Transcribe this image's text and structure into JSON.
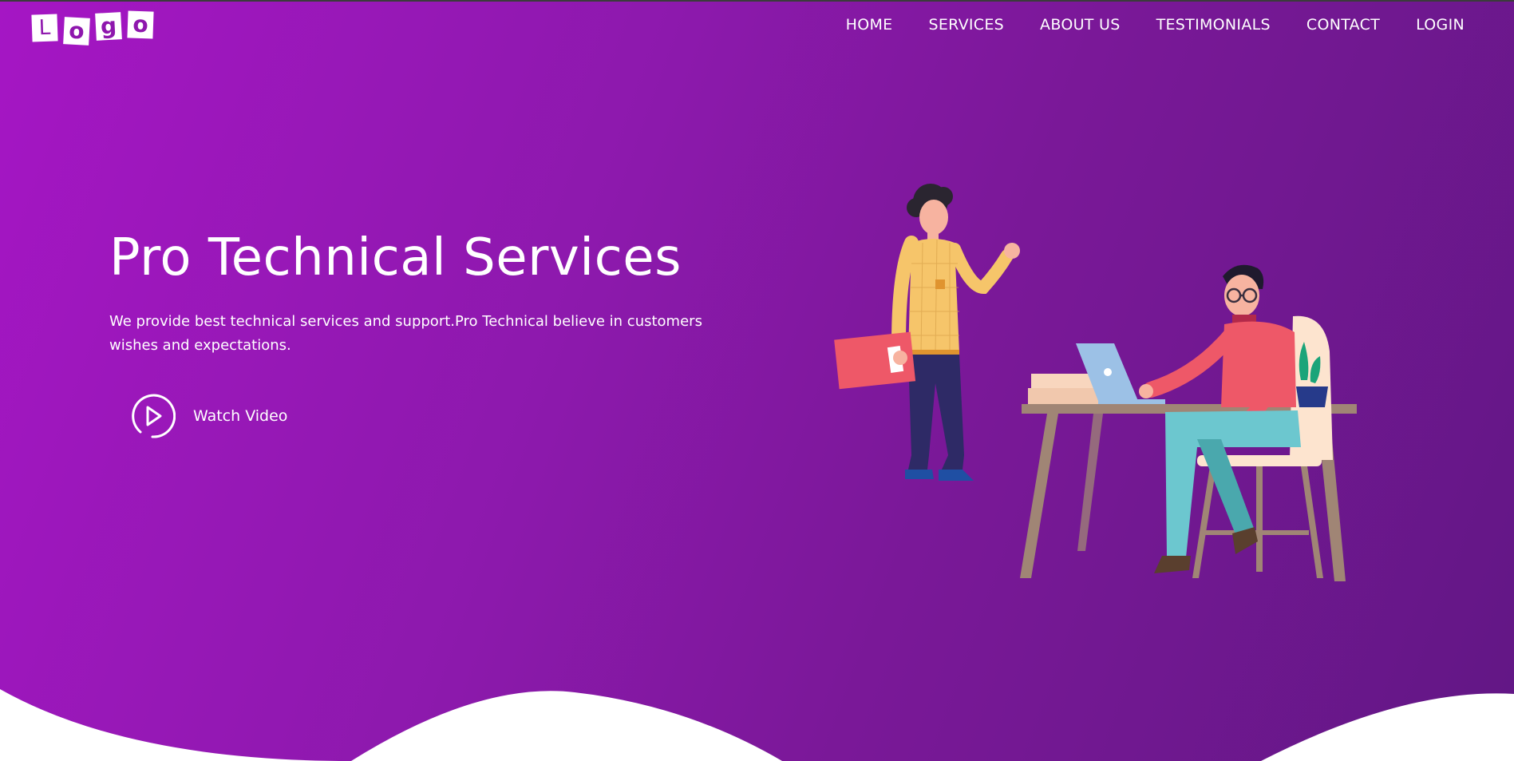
{
  "logo": {
    "letters": [
      "L",
      "o",
      "g",
      "o"
    ]
  },
  "nav": {
    "items": [
      {
        "label": "HOME"
      },
      {
        "label": "SERVICES"
      },
      {
        "label": "ABOUT US"
      },
      {
        "label": "TESTIMONIALS"
      },
      {
        "label": "CONTACT"
      },
      {
        "label": "LOGIN"
      }
    ]
  },
  "hero": {
    "title": "Pro Technical Services",
    "description": "We provide best technical services and support.Pro Technical believe in customers wishes and expectations.",
    "watch_label": "Watch Video",
    "play_icon": "play-circle-icon"
  },
  "illustration": {
    "subject": "office-workers-illustration"
  },
  "colors": {
    "gradient_start": "#a516c4",
    "gradient_end": "#621785",
    "text": "#ffffff",
    "wave": "#ffffff"
  }
}
